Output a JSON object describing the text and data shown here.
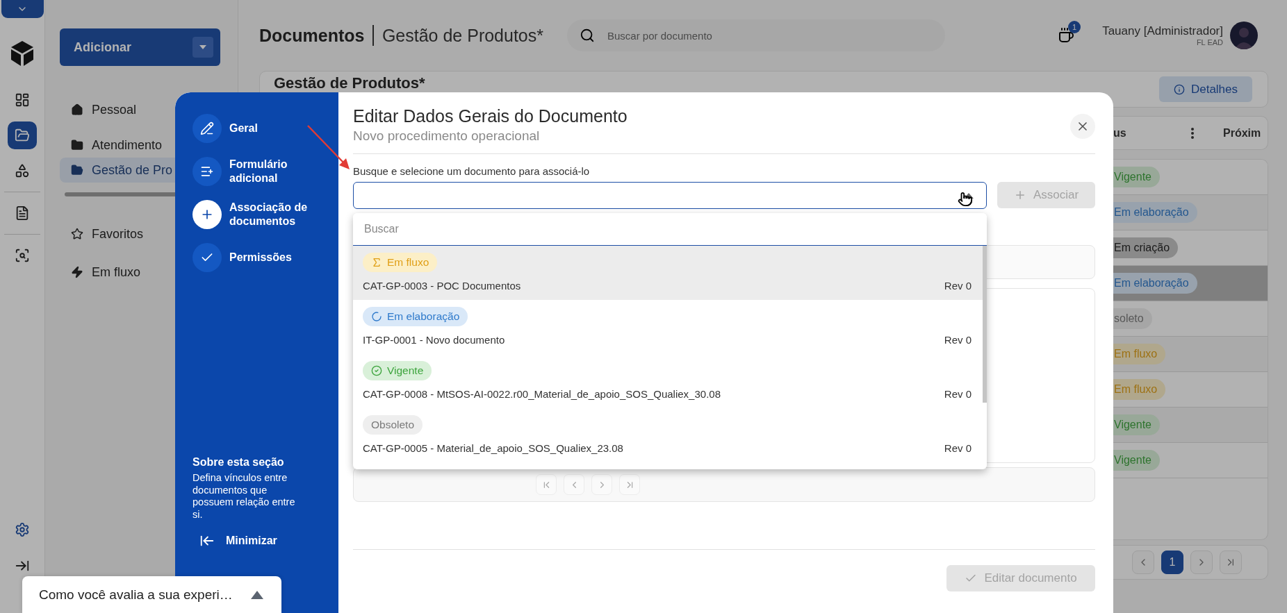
{
  "rail": {
    "groups": [
      {
        "items": [
          {
            "kind": "dashboard",
            "selected": false
          },
          {
            "kind": "folder",
            "selected": true
          },
          {
            "kind": "shapes",
            "selected": false
          }
        ]
      },
      {
        "items": [
          {
            "kind": "document",
            "selected": false
          }
        ]
      },
      {
        "items": [
          {
            "kind": "scan",
            "selected": false
          }
        ]
      }
    ],
    "footer_items": [
      {
        "kind": "settings"
      },
      {
        "kind": "expand"
      }
    ]
  },
  "nav": {
    "add_button": "Adicionar",
    "items": [
      {
        "label": "Pessoal",
        "kind": "home",
        "selected": false
      },
      {
        "label": "Atendimento",
        "kind": "folder",
        "selected": false
      },
      {
        "label": "Gestão de Pro",
        "kind": "folder-open",
        "selected": true
      }
    ],
    "secondary_items": [
      {
        "label": "Favoritos",
        "kind": "star",
        "selected": false
      },
      {
        "label": "Em fluxo",
        "kind": "bolt",
        "selected": false
      }
    ]
  },
  "header": {
    "title": "Documentos",
    "subtitle": "Gestão de Produtos*",
    "search_placeholder": "Buscar por documento",
    "notification_count": "1",
    "user_name": "Tauany [Administrador]",
    "user_org": "FL EAD"
  },
  "page": {
    "title": "Gestão de Produtos*",
    "details_button": "Detalhes",
    "table": {
      "columns": [
        "us",
        "Próxim"
      ],
      "rows": [
        {
          "status": {
            "label": "Vigente",
            "kind": "current"
          },
          "selected": false
        },
        {
          "status": {
            "label": "Em elaboração",
            "kind": "draft"
          },
          "selected": false
        },
        {
          "status": {
            "label": "Em criação",
            "kind": "creating"
          },
          "selected": false
        },
        {
          "status": {
            "label": "Em elaboração",
            "kind": "draft"
          },
          "selected": true
        },
        {
          "status": {
            "label": "soleto",
            "kind": "obsolete"
          },
          "selected": false
        },
        {
          "status": {
            "label": "Em fluxo",
            "kind": "flow"
          },
          "selected": false
        },
        {
          "status": {
            "label": "Em fluxo",
            "kind": "flow"
          },
          "selected": false
        },
        {
          "status": {
            "label": "Vigente",
            "kind": "current"
          },
          "selected": false
        },
        {
          "status": {
            "label": "Vigente",
            "kind": "current"
          },
          "selected": false
        }
      ]
    },
    "pagination": {
      "pages": [
        {
          "label": "1",
          "selected": true
        }
      ]
    }
  },
  "modal": {
    "steps": [
      {
        "label": "Geral",
        "kind": "edit",
        "selected": false
      },
      {
        "label": "Formulário adicional",
        "kind": "form",
        "selected": false
      },
      {
        "label": "Associação de documentos",
        "kind": "plus",
        "selected": true
      },
      {
        "label": "Permissões",
        "kind": "check",
        "selected": false
      }
    ],
    "help_title": "Sobre esta seção",
    "help_text": "Defina vínculos entre documentos que possuem relação entre si.",
    "minimize": "Minimizar",
    "title": "Editar Dados Gerais do Documento",
    "subtitle": "Novo procedimento operacional",
    "field_label": "Busque e selecione um documento para associá-lo",
    "associate_button": {
      "label": "Associar",
      "disabled": true
    },
    "dropdown": {
      "search_placeholder": "Buscar",
      "options": [
        {
          "status": {
            "label": "Em fluxo",
            "kind": "flow"
          },
          "title": "CAT-GP-0003 - POC Documentos",
          "revision": "Rev 0",
          "highlighted": true
        },
        {
          "status": {
            "label": "Em elaboração",
            "kind": "draft"
          },
          "title": "IT-GP-0001 - Novo documento",
          "revision": "Rev 0",
          "highlighted": false
        },
        {
          "status": {
            "label": "Vigente",
            "kind": "current"
          },
          "title": "CAT-GP-0008 - MtSOS-AI-0022.r00_Material_de_apoio_SOS_Qualiex_30.08",
          "revision": "Rev 0",
          "highlighted": false
        },
        {
          "status": {
            "label": "Obsoleto",
            "kind": "obsolete"
          },
          "title": "CAT-GP-0005 - Material_de_apoio_SOS_Qualiex_23.08",
          "revision": "Rev 0",
          "highlighted": false
        }
      ]
    },
    "submit_button": {
      "label": "Editar documento",
      "disabled": true
    }
  },
  "feedback": {
    "text": "Como você avalia a sua experi…"
  }
}
